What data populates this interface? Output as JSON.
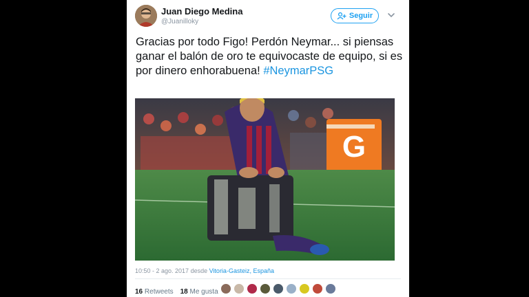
{
  "user": {
    "name": "Juan Diego Medina",
    "handle": "@Juanilloky"
  },
  "follow_button": {
    "label": "Seguir"
  },
  "tweet": {
    "text": "Gracias por todo Figo! Perdón Neymar... si piensas ganar el balón de oro te equivocaste de equipo, si es por dinero enhorabuena!",
    "hashtag": "#NeymarPSG"
  },
  "meta": {
    "time": "10:50 - 2 ago. 2017 desde ",
    "location": "Vitoria-Gasteiz, España"
  },
  "stats": {
    "retweets_count": "16",
    "retweets_label": "Retweets",
    "likes_count": "18",
    "likes_label": "Me gusta"
  },
  "likers": [
    {
      "color": "#8a6a5a"
    },
    {
      "color": "#c9b9a8"
    },
    {
      "color": "#b02a4a"
    },
    {
      "color": "#5a5a3a"
    },
    {
      "color": "#4a5a6a"
    },
    {
      "color": "#9ab0c8"
    },
    {
      "color": "#d8c820"
    },
    {
      "color": "#c04a3a"
    },
    {
      "color": "#6a7a9a"
    }
  ],
  "colors": {
    "accent": "#1da1f2",
    "text": "#14171a",
    "muted": "#8a95a1"
  },
  "icons": {
    "follow": "add-person-icon",
    "caret": "chevron-down-icon"
  }
}
